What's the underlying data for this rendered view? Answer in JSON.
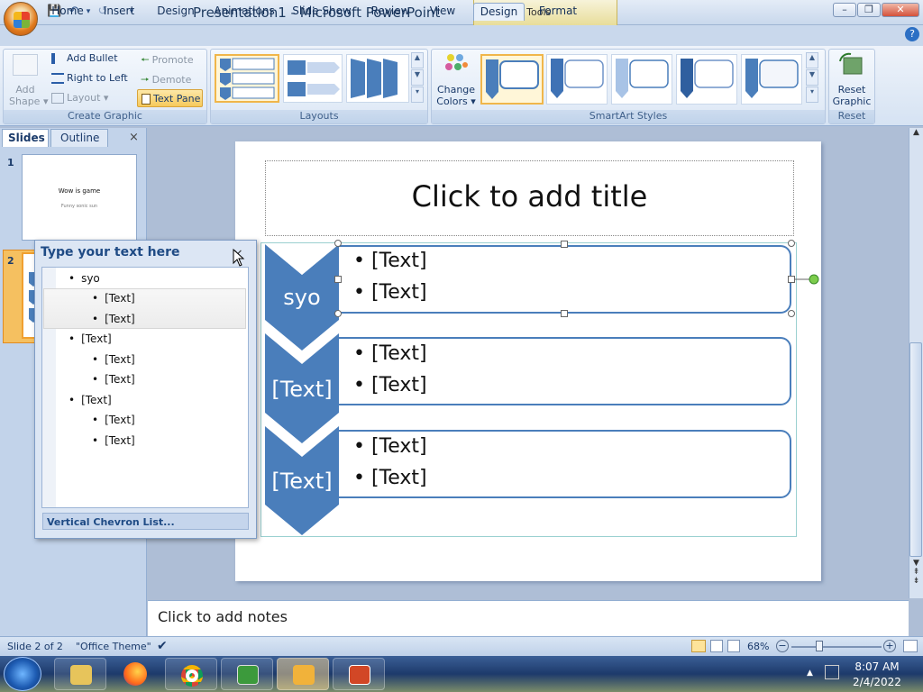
{
  "window": {
    "app_title": "Presentation1 - Microsoft PowerPoint",
    "context_title": "SmartArt Tools",
    "minimize": "–",
    "restore": "❐",
    "close": "✕"
  },
  "qat": {
    "save_icon": "save-icon",
    "undo_icon": "undo-icon",
    "redo_icon": "redo-icon",
    "customize": "▾"
  },
  "tabs": [
    {
      "label": "Home"
    },
    {
      "label": "Insert"
    },
    {
      "label": "Design"
    },
    {
      "label": "Animations"
    },
    {
      "label": "Slide Show"
    },
    {
      "label": "Review"
    },
    {
      "label": "View"
    },
    {
      "label": "Design",
      "active": true
    },
    {
      "label": "Format"
    }
  ],
  "help": "?",
  "ribbon": {
    "create_graphic": {
      "label": "Create Graphic",
      "add_shape": "Add\nShape",
      "add_shape_l1": "Add",
      "add_shape_l2": "Shape ▾",
      "add_bullet": "Add Bullet",
      "right_to_left": "Right to Left",
      "layout": "Layout ▾",
      "promote": "Promote",
      "demote": "Demote",
      "text_pane": "Text Pane"
    },
    "layouts": {
      "label": "Layouts"
    },
    "change_colors": {
      "l1": "Change",
      "l2": "Colors ▾"
    },
    "smartart_styles": {
      "label": "SmartArt Styles"
    },
    "reset": {
      "label": "Reset",
      "l1": "Reset",
      "l2": "Graphic"
    }
  },
  "left_pane": {
    "tab_slides": "Slides",
    "tab_outline": "Outline",
    "close": "×",
    "slides": [
      {
        "number": "1",
        "title": "Wow is game",
        "subtitle": "Funny sonic sun"
      },
      {
        "number": "2"
      }
    ]
  },
  "slide": {
    "title_placeholder": "Click to add title",
    "smartart": {
      "rows": [
        {
          "label": "syo",
          "bullets": [
            "[Text]",
            "[Text]"
          ]
        },
        {
          "label": "[Text]",
          "bullets": [
            "[Text]",
            "[Text]"
          ]
        },
        {
          "label": "[Text]",
          "bullets": [
            "[Text]",
            "[Text]"
          ]
        }
      ]
    }
  },
  "text_pane": {
    "heading": "Type your text here",
    "close": "×",
    "items": [
      {
        "level": 1,
        "text": "syo"
      },
      {
        "level": 2,
        "text": "[Text]"
      },
      {
        "level": 2,
        "text": "[Text]"
      },
      {
        "level": 1,
        "text": "[Text]"
      },
      {
        "level": 2,
        "text": "[Text]"
      },
      {
        "level": 2,
        "text": "[Text]"
      },
      {
        "level": 1,
        "text": "[Text]"
      },
      {
        "level": 2,
        "text": "[Text]"
      },
      {
        "level": 2,
        "text": "[Text]"
      }
    ],
    "footer": "Vertical Chevron List..."
  },
  "notes": {
    "placeholder": "Click to add notes"
  },
  "status": {
    "slide_info": "Slide 2 of 2",
    "theme": "\"Office Theme\"",
    "zoom": "68%"
  },
  "taskbar": {
    "time": "8:07 AM",
    "date": "2/4/2022"
  },
  "colors": {
    "accent": "#4a7ebb",
    "ribbon": "#dce7f5",
    "selected": "#f6c95b"
  }
}
